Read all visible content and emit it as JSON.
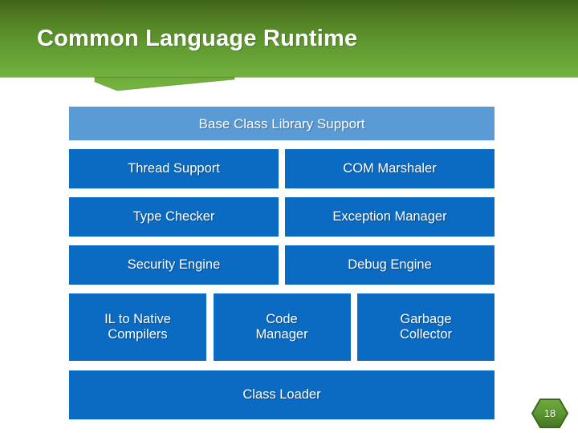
{
  "slide": {
    "title": "Common Language Runtime",
    "page_number": "18"
  },
  "theme": {
    "header_green_top": "#49711F",
    "header_green_bottom": "#70B03C",
    "header_notch_green": "#6FAE3B",
    "box_blue": "#0B6AC2",
    "header_box_blue": "#5B9BD5",
    "badge_green": "#5F9C33",
    "badge_border_green": "#3E6B1E",
    "text_white": "#FFFFFF"
  },
  "diagram": {
    "name": "clr-architecture-diagram",
    "rows": [
      {
        "id": "row-bcl",
        "columns": 1,
        "cells": [
          {
            "label": "Base Class Library Support"
          }
        ]
      },
      {
        "id": "row-two-1",
        "columns": 2,
        "cells": [
          {
            "label": "Thread Support"
          },
          {
            "label": "COM Marshaler"
          }
        ]
      },
      {
        "id": "row-two-2",
        "columns": 2,
        "cells": [
          {
            "label": "Type Checker"
          },
          {
            "label": "Exception Manager"
          }
        ]
      },
      {
        "id": "row-two-3",
        "columns": 2,
        "cells": [
          {
            "label": "Security Engine"
          },
          {
            "label": "Debug Engine"
          }
        ]
      },
      {
        "id": "row-three",
        "columns": 3,
        "cells": [
          {
            "label": "IL to Native\nCompilers"
          },
          {
            "label": "Code\nManager"
          },
          {
            "label": "Garbage\nCollector"
          }
        ]
      },
      {
        "id": "row-loader",
        "columns": 1,
        "cells": [
          {
            "label": "Class Loader"
          }
        ]
      }
    ]
  }
}
